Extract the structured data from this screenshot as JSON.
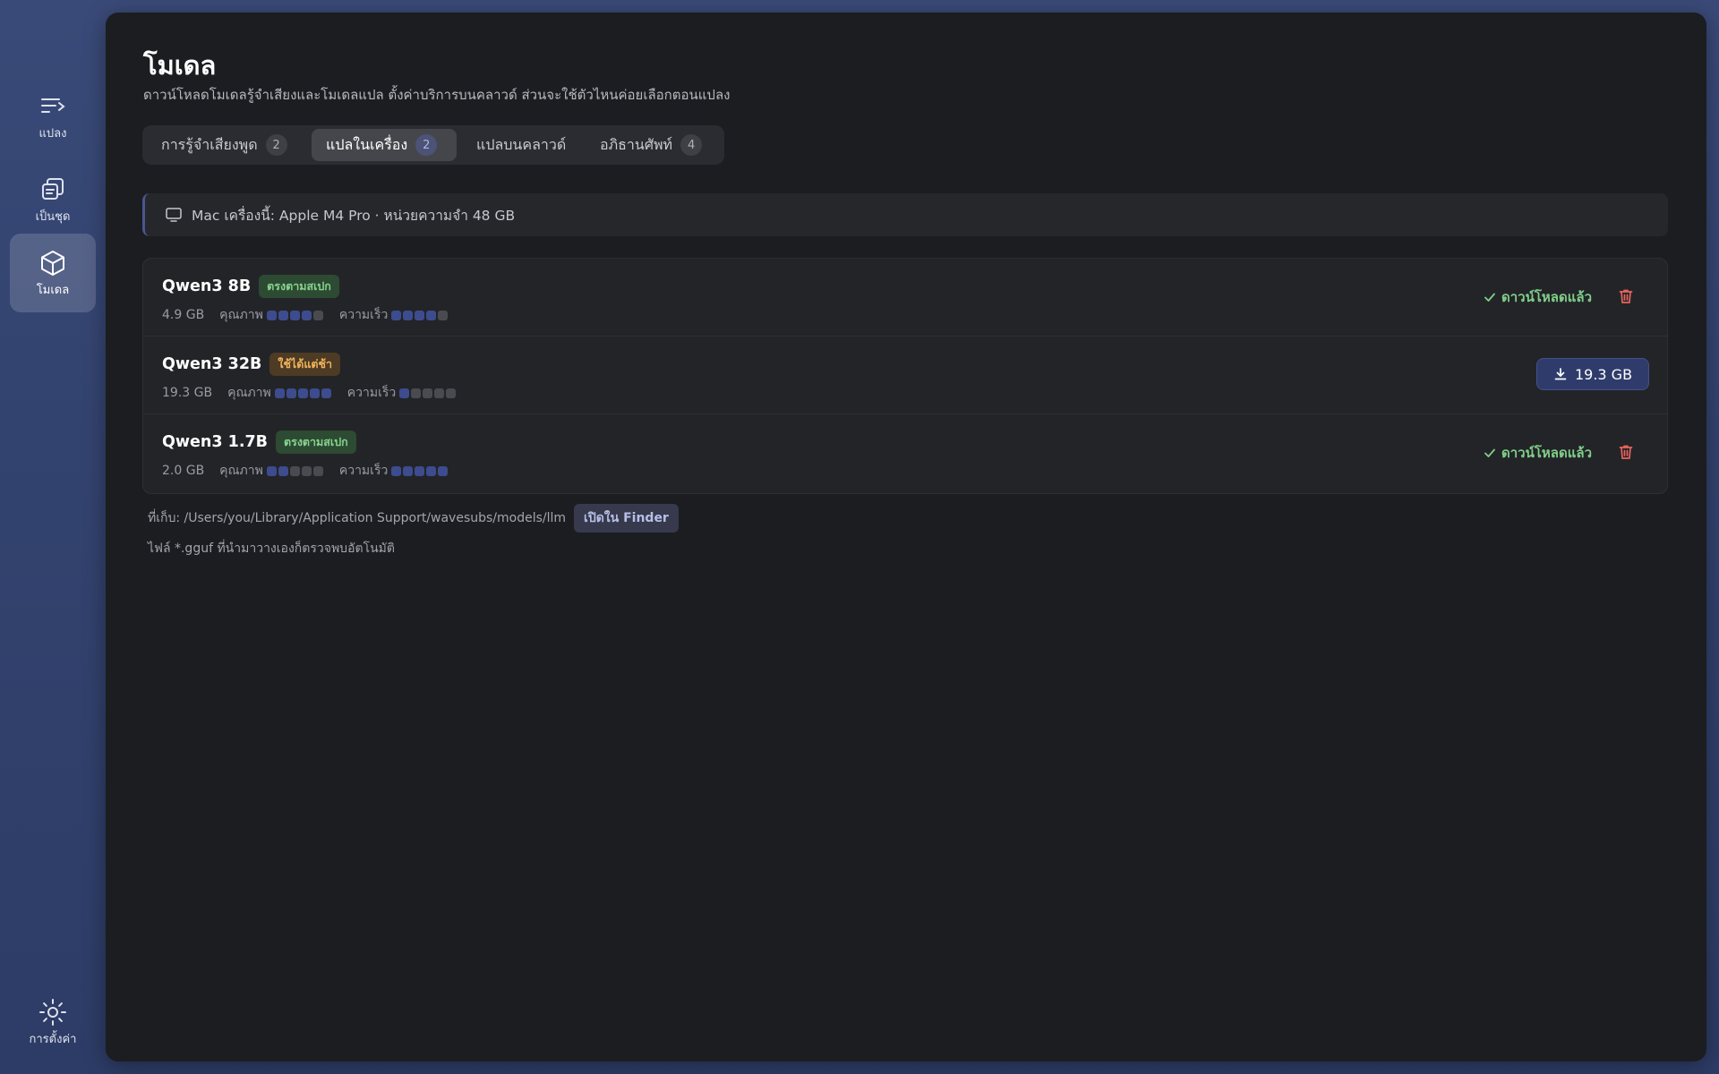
{
  "sidebar": {
    "items": [
      {
        "label": "แปลง",
        "icon": "translate-list-icon"
      },
      {
        "label": "เป็นชุด",
        "icon": "batch-stack-icon"
      },
      {
        "label": "โมเดล",
        "icon": "cube-icon",
        "active": true
      }
    ],
    "settings": {
      "label": "การตั้งค่า",
      "icon": "sun-gear-icon"
    }
  },
  "header": {
    "title": "โมเดล",
    "subtitle": "ดาวน์โหลดโมเดลรู้จำเสียงและโมเดลแปล ตั้งค่าบริการบนคลาวด์ ส่วนจะใช้ตัวไหนค่อยเลือกตอนแปลง"
  },
  "tabs": [
    {
      "label": "การรู้จำเสียงพูด",
      "count": "2"
    },
    {
      "label": "แปลในเครื่อง",
      "count": "2",
      "active": true
    },
    {
      "label": "แปลบนคลาวด์",
      "count": null
    },
    {
      "label": "อภิธานศัพท์",
      "count": "4"
    }
  ],
  "info": {
    "text": "Mac เครื่องนี้: Apple M4 Pro · หน่วยความจำ 48 GB",
    "icon": "monitor-icon"
  },
  "models": [
    {
      "name": "Qwen3 8B",
      "badge": "ตรงตามสเปก",
      "badge_color": "#86d38f",
      "size": "4.9 GB",
      "quality_label": "คุณภาพ",
      "quality": 4,
      "speed_label": "ความเร็ว",
      "speed": 4,
      "status": "ดาวน์โหลดแล้ว"
    },
    {
      "name": "Qwen3 32B",
      "badge": "ใช้ได้แต่ช้า",
      "badge_color": "#f1b35c",
      "size": "19.3 GB",
      "quality_label": "คุณภาพ",
      "quality": 5,
      "speed_label": "ความเร็ว",
      "speed": 1,
      "download_label": "19.3 GB"
    },
    {
      "name": "Qwen3 1.7B",
      "badge": "ตรงตามสเปก",
      "badge_color": "#86d38f",
      "size": "2.0 GB",
      "quality_label": "คุณภาพ",
      "quality": 2,
      "speed_label": "ความเร็ว",
      "speed": 5,
      "status": "ดาวน์โหลดแล้ว"
    }
  ],
  "footer": {
    "path_text": "ที่เก็บ: /Users/you/Library/Application Support/wavesubs/models/llm",
    "finder_button": "เปิดใน Finder",
    "note": "ไฟล์ *.gguf ที่นำมาวางเองก็ตรวจพบอัตโนมัติ"
  },
  "colors": {
    "accent": "#3d4c8e",
    "success": "#7fcf89",
    "danger": "#e8645a",
    "warning": "#f1b35c",
    "panel_bg": "#1c1d21"
  }
}
